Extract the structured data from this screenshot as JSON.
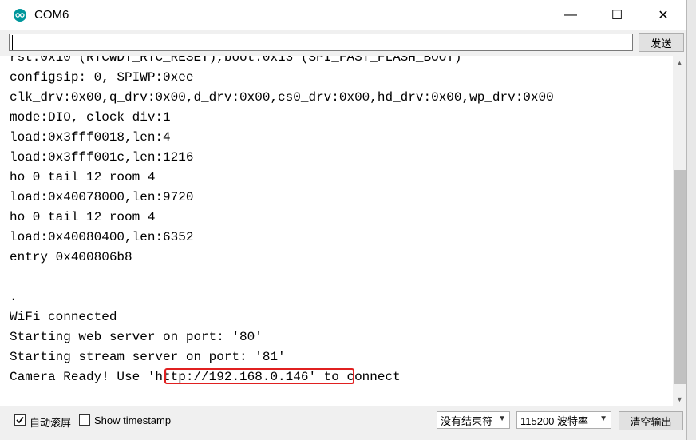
{
  "window": {
    "title": "COM6",
    "minimize_glyph": "—",
    "maximize_glyph": "☐",
    "close_glyph": "✕"
  },
  "toolbar": {
    "input_value": "",
    "send_label": "发送"
  },
  "console": {
    "lines": [
      "rst:0x10 (RTCWDT_RTC_RESET),boot:0x13 (SPI_FAST_FLASH_BOOT)",
      "configsip: 0, SPIWP:0xee",
      "clk_drv:0x00,q_drv:0x00,d_drv:0x00,cs0_drv:0x00,hd_drv:0x00,wp_drv:0x00",
      "mode:DIO, clock div:1",
      "load:0x3fff0018,len:4",
      "load:0x3fff001c,len:1216",
      "ho 0 tail 12 room 4",
      "load:0x40078000,len:9720",
      "ho 0 tail 12 room 4",
      "load:0x40080400,len:6352",
      "entry 0x400806b8",
      "",
      ".",
      "WiFi connected",
      "Starting web server on port: '80'",
      "Starting stream server on port: '81'",
      "Camera Ready! Use 'http://192.168.0.146' to connect"
    ]
  },
  "statusbar": {
    "autoscroll_label": "自动滚屏",
    "autoscroll_checked": true,
    "timestamp_label": "Show timestamp",
    "timestamp_checked": false,
    "line_ending": "没有结束符",
    "baud_rate": "115200 波特率",
    "clear_label": "清空输出"
  }
}
